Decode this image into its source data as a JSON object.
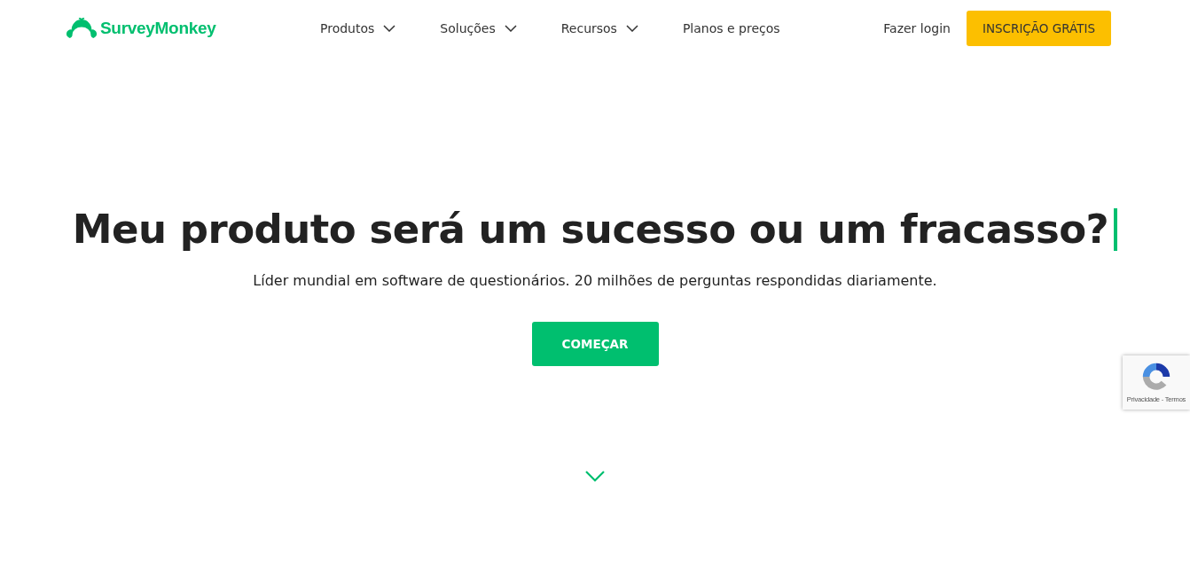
{
  "logo": {
    "text": "SurveyMonkey"
  },
  "nav": [
    {
      "label": "Produtos",
      "has_menu": true
    },
    {
      "label": "Soluções",
      "has_menu": true
    },
    {
      "label": "Recursos",
      "has_menu": true
    },
    {
      "label": "Planos e preços",
      "has_menu": false
    }
  ],
  "login": "Fazer login",
  "signup": "INSCRIÇÃO GRÁTIS",
  "hero": {
    "title": "Meu produto será um sucesso ou um fracasso?",
    "subtitle": "Líder mundial em software de questionários. 20 milhões de perguntas respondidas diariamente.",
    "button": "COMEÇAR"
  },
  "recaptcha": {
    "text": "Privacidade - Termos"
  }
}
